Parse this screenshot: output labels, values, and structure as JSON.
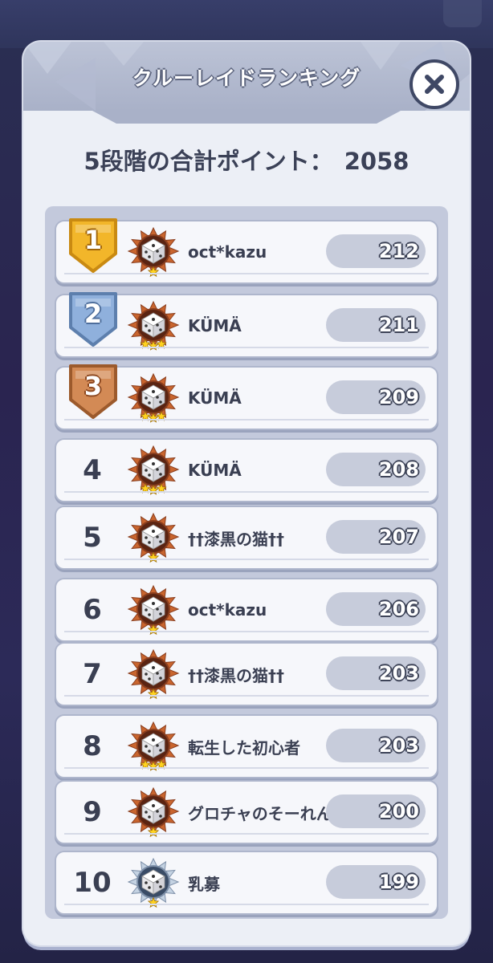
{
  "dialog": {
    "title": "クルーレイドランキング",
    "close_icon": "close-icon",
    "total_label": "5段階の合計ポイント：",
    "total_value": "2058"
  },
  "colors": {
    "gold": "#f2b62a",
    "silver": "#8fb0dc",
    "bronze": "#d38a55",
    "text_dark": "#3a3f52",
    "panel_bg": "#eceff6"
  },
  "rankings": [
    {
      "rank": "1",
      "name": "oct*kazu",
      "score": "212",
      "medal": "gold-rank-shield",
      "badge": "bronze-dice-badge-1star"
    },
    {
      "rank": "2",
      "name": "KÜMÄ",
      "score": "211",
      "medal": "silver-rank-shield",
      "badge": "bronze-dice-badge-3star"
    },
    {
      "rank": "3",
      "name": "KÜMÄ",
      "score": "209",
      "medal": "bronze-rank-shield",
      "badge": "bronze-dice-badge-3star"
    },
    {
      "rank": "4",
      "name": "KÜMÄ",
      "score": "208",
      "badge": "bronze-dice-badge-3star"
    },
    {
      "rank": "5",
      "name": "††漆黒の猫††",
      "score": "207",
      "badge": "bronze-dice-badge-1star"
    },
    {
      "rank": "6",
      "name": "oct*kazu",
      "score": "206",
      "badge": "bronze-dice-badge-1star"
    },
    {
      "rank": "7",
      "name": "††漆黒の猫††",
      "score": "203",
      "badge": "bronze-dice-badge-1star"
    },
    {
      "rank": "8",
      "name": "転生した初心者",
      "score": "203",
      "badge": "bronze-dice-badge-3star"
    },
    {
      "rank": "9",
      "name": "グロチャのそーれん",
      "score": "200",
      "badge": "bronze-dice-badge-1star"
    },
    {
      "rank": "10",
      "name": "乳募",
      "score": "199",
      "badge": "silver-dice-badge-1star"
    }
  ]
}
